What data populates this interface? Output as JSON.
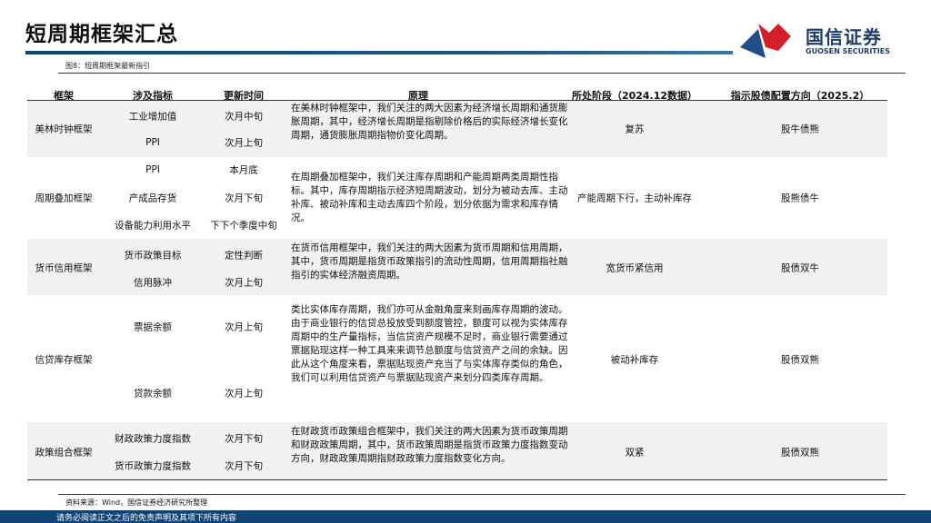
{
  "header": {
    "title": "短周期框架汇总",
    "logo_cn": "国信证券",
    "logo_en": "GUOSEN SECURITIES"
  },
  "figure_caption": "图8：短周期框架最新指引",
  "table": {
    "columns": [
      "框架",
      "涉及指标",
      "更新时间",
      "原理",
      "所处阶段（2024.12数据）",
      "指示股债配置方向（2025.2）"
    ],
    "rows": [
      {
        "framework": "美林时钟框架",
        "indicators": [
          {
            "name": "工业增加值",
            "time": "次月中旬"
          },
          {
            "name": "PPI",
            "time": "次月上旬"
          }
        ],
        "principle": "在美林时钟框架中，我们关注的两大因素为经济增长周期和通货膨胀周期，其中，经济增长周期是指剔除价格后的实际经济增长变化周期，通货膨胀周期指物价变化周期。",
        "stage": "复苏",
        "direction": "股牛债熊"
      },
      {
        "framework": "周期叠加框架",
        "indicators": [
          {
            "name": "PPI",
            "time": "本月底"
          },
          {
            "name": "产成品存货",
            "time": "次月下旬"
          },
          {
            "name": "设备能力利用水平",
            "time": "下下个季度中旬"
          }
        ],
        "principle": "在周期叠加框架中，我们关注库存周期和产能周期两类周期性指标。其中，库存周期指示经济短周期波动，划分为被动去库、主动补库、被动补库和主动去库四个阶段，划分依据为需求和库存情况。",
        "stage": "产能周期下行，主动补库存",
        "direction": "股熊债牛"
      },
      {
        "framework": "货币信用框架",
        "indicators": [
          {
            "name": "货币政策目标",
            "time": "定性判断"
          },
          {
            "name": "信用脉冲",
            "time": "次月上旬"
          }
        ],
        "principle": "在货币信用框架中，我们关注的两大因素为货币周期和信用周期，其中，货币周期是指货币政策指引的流动性周期，信用周期指社融指引的实体经济融资周期。",
        "stage": "宽货币紧信用",
        "direction": "股债双牛"
      },
      {
        "framework": "信贷库存框架",
        "indicators": [
          {
            "name": "票据余额",
            "time": "次月上旬"
          },
          {
            "name": "贷款余额",
            "time": "次月上旬"
          }
        ],
        "principle": "类比实体库存周期，我们亦可从金融角度来刻画库存周期的波动。由于商业银行的信贷总投放受到额度管控，额度可以视为实体库存周期中的生产量指标，当信贷资产规模不足时，商业银行需要通过票据贴现这样一种工具来来调节总额度与信贷资产之间的余缺。因此从这个角度来看，票据贴现资产充当了与实体库存类似的角色，我们可以利用信贷资产与票据贴现资产来划分四类库存周期。",
        "stage": "被动补库存",
        "direction": "股债双熊"
      },
      {
        "framework": "政策组合框架",
        "indicators": [
          {
            "name": "财政政策力度指数",
            "time": "次月下旬"
          },
          {
            "name": "货币政策力度指数",
            "time": "次月下旬"
          }
        ],
        "principle": "在财政货币政策组合框架中，我们关注的两大因素为货币政策周期和财政政策周期，其中，货币政策周期是指货币政策力度指数变动方向，财政政策周期指财政政策力度指数变化方向。",
        "stage": "双紧",
        "direction": "股债双熊"
      }
    ]
  },
  "source": "资料来源：Wind，国信证券经济研究所整理",
  "disclaimer": "请务必阅读正文之后的免责声明及其项下所有内容"
}
